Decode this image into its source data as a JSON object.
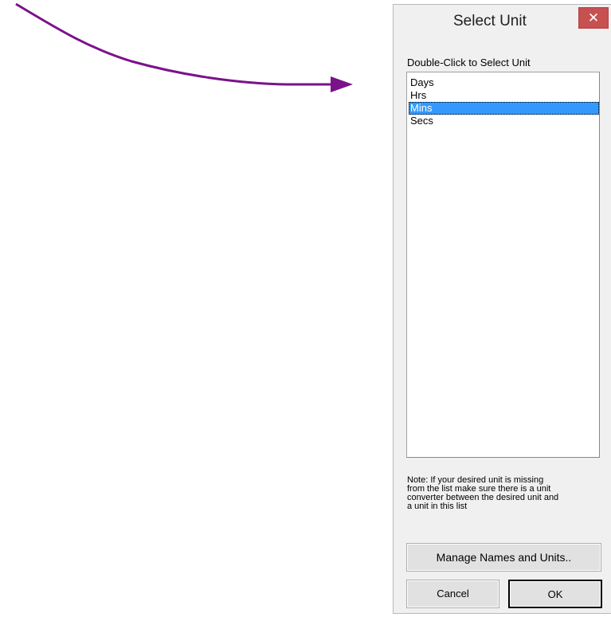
{
  "dialog": {
    "title": "Select Unit",
    "close_glyph": "✕",
    "instruction": "Double-Click to Select Unit",
    "units": [
      "Days",
      "Hrs",
      "Mins",
      "Secs"
    ],
    "selected_unit": "Mins",
    "note": "Note: If your desired unit is missing\nfrom the list make sure there is a unit\nconverter between the desired unit and\na unit in this list",
    "buttons": {
      "manage": "Manage Names and Units..",
      "cancel": "Cancel",
      "ok": "OK"
    }
  },
  "colors": {
    "arrow": "#7b128a",
    "selection": "#3399ff",
    "close_button": "#c75050"
  }
}
